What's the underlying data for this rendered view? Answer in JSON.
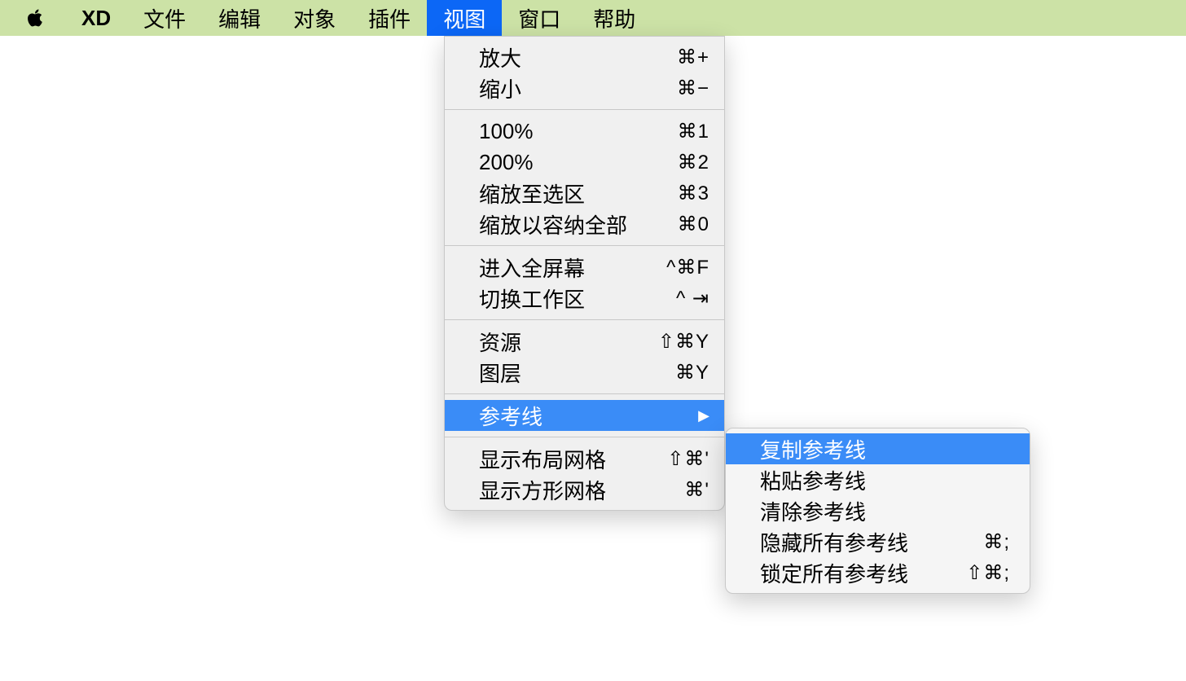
{
  "menubar": {
    "appName": "XD",
    "items": [
      {
        "label": "文件"
      },
      {
        "label": "编辑"
      },
      {
        "label": "对象"
      },
      {
        "label": "插件"
      },
      {
        "label": "视图",
        "active": true
      },
      {
        "label": "窗口"
      },
      {
        "label": "帮助"
      }
    ]
  },
  "dropdown": {
    "groups": [
      [
        {
          "label": "放大",
          "shortcut": "⌘+"
        },
        {
          "label": "缩小",
          "shortcut": "⌘−"
        }
      ],
      [
        {
          "label": "100%",
          "shortcut": "⌘1"
        },
        {
          "label": "200%",
          "shortcut": "⌘2"
        },
        {
          "label": "缩放至选区",
          "shortcut": "⌘3"
        },
        {
          "label": "缩放以容纳全部",
          "shortcut": "⌘0"
        }
      ],
      [
        {
          "label": "进入全屏幕",
          "shortcut": "^⌘F"
        },
        {
          "label": "切换工作区",
          "shortcut": "^  ⇥"
        }
      ],
      [
        {
          "label": "资源",
          "shortcut": "⇧⌘Y"
        },
        {
          "label": "图层",
          "shortcut": "⌘Y"
        }
      ],
      [
        {
          "label": "参考线",
          "submenu": true,
          "highlighted": true
        }
      ],
      [
        {
          "label": "显示布局网格",
          "shortcut": "⇧⌘'"
        },
        {
          "label": "显示方形网格",
          "shortcut": "⌘'"
        }
      ]
    ]
  },
  "submenu": {
    "items": [
      {
        "label": "复制参考线",
        "highlighted": true
      },
      {
        "label": "粘贴参考线"
      },
      {
        "label": "清除参考线"
      },
      {
        "label": "隐藏所有参考线",
        "shortcut": "⌘;"
      },
      {
        "label": "锁定所有参考线",
        "shortcut": "⇧⌘;"
      }
    ]
  }
}
